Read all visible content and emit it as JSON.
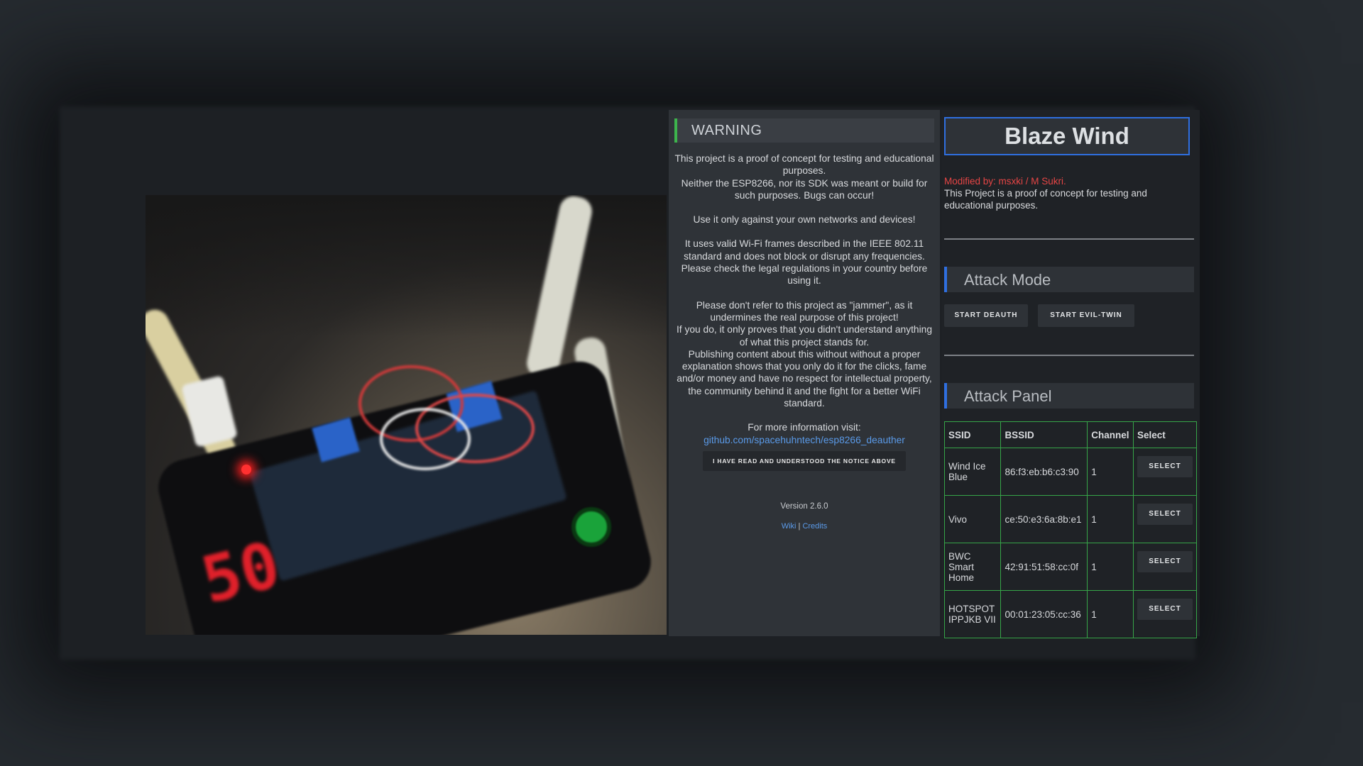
{
  "warning": {
    "heading": "WARNING",
    "para1_line1": "This project is a proof of concept for testing and educational purposes.",
    "para1_line2": "Neither the ESP8266, nor its SDK was meant or build for such purposes. Bugs can occur!",
    "para2": "Use it only against your own networks and devices!",
    "para3": "It uses valid Wi-Fi frames described in the IEEE 802.11 standard and does not block or disrupt any frequencies. Please check the legal regulations in your country before using it.",
    "para4_line1": "Please don't refer to this project as \"jammer\", as it undermines the real purpose of this project!",
    "para4_line2": "If you do, it only proves that you didn't understand anything of what this project stands for.",
    "para4_line3": "Publishing content about this without without a proper explanation shows that you only do it for the clicks, fame and/or money and have no respect for intellectual property, the community behind it and the fight for a better WiFi standard.",
    "info_label": "For more information visit:",
    "info_link": "github.com/spacehuhntech/esp8266_deauther",
    "ack_button": "I HAVE READ AND UNDERSTOOD THE NOTICE ABOVE",
    "version": "Version 2.6.0",
    "wiki_link": "Wiki",
    "separator": "|",
    "credits_link": "Credits"
  },
  "panel": {
    "title": "Blaze Wind",
    "modified_by": "Modified by: msxki / M Sukri.",
    "description": "This Project is a proof of concept for testing and educational purposes.",
    "attack_mode_heading": "Attack Mode",
    "start_deauth": "START DEAUTH",
    "start_evil_twin": "START EVIL-TWIN",
    "attack_panel_heading": "Attack Panel",
    "table": {
      "headers": [
        "SSID",
        "BSSID",
        "Channel",
        "Select"
      ],
      "rows": [
        {
          "ssid": "Wind Ice Blue",
          "bssid": "86:f3:eb:b6:c3:90",
          "channel": "1",
          "action": "SELECT"
        },
        {
          "ssid": "Vivo",
          "bssid": "ce:50:e3:6a:8b:e1",
          "channel": "1",
          "action": "SELECT"
        },
        {
          "ssid": "BWC Smart Home",
          "bssid": "42:91:51:58:cc:0f",
          "channel": "1",
          "action": "SELECT"
        },
        {
          "ssid": "HOTSPOT IPPJKB VII",
          "bssid": "00:01:23:05:cc:36",
          "channel": "1",
          "action": "SELECT"
        }
      ]
    }
  },
  "photo": {
    "display_digits": "50"
  },
  "colors": {
    "accent_green": "#3db44d",
    "accent_blue": "#2f6fe0",
    "link_blue": "#5a9ae8",
    "modified_red": "#e64545",
    "table_border": "#36a548"
  }
}
